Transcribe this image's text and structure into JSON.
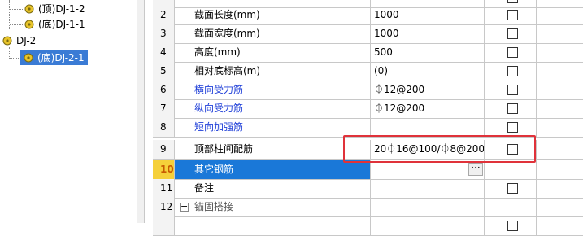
{
  "tree": {
    "nodes": [
      {
        "label": "(顶)DJ-1-2"
      },
      {
        "label": "(底)DJ-1-1"
      },
      {
        "label": "DJ-2"
      },
      {
        "label": "(底)DJ-2-1"
      }
    ]
  },
  "grid": {
    "rows": [
      {
        "num": "",
        "name": "",
        "value": ""
      },
      {
        "num": "2",
        "name": "截面长度(mm)",
        "value": "1000"
      },
      {
        "num": "3",
        "name": "截面宽度(mm)",
        "value": "1000"
      },
      {
        "num": "4",
        "name": "高度(mm)",
        "value": "500"
      },
      {
        "num": "5",
        "name": "相对底标高(m)",
        "value": "(0)"
      },
      {
        "num": "6",
        "name": "横向受力筋",
        "value": "⏀12@200"
      },
      {
        "num": "7",
        "name": "纵向受力筋",
        "value": "⏀12@200"
      },
      {
        "num": "8",
        "name": "短向加强筋",
        "value": ""
      },
      {
        "num": "9",
        "name": "顶部柱间配筋",
        "value": "20⏀16@100/⏀8@200"
      },
      {
        "num": "10",
        "name": "其它钢筋",
        "value": "",
        "ellipsis": "···"
      },
      {
        "num": "11",
        "name": "备注",
        "value": ""
      },
      {
        "num": "12",
        "name": "锚固搭接",
        "value": "",
        "expander": "−"
      },
      {
        "num": "",
        "name": "",
        "value": ""
      }
    ]
  }
}
